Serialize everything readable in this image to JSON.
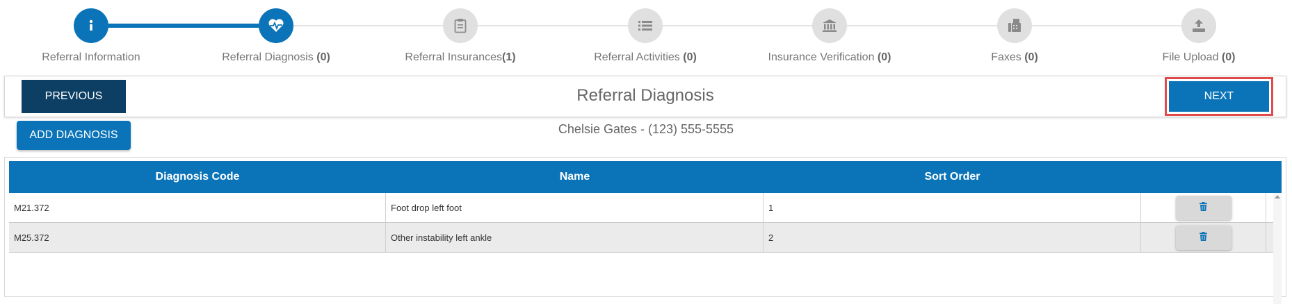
{
  "stepper": {
    "steps": [
      {
        "label": "Referral Information",
        "count": "",
        "icon": "info-icon",
        "active": true
      },
      {
        "label": "Referral Diagnosis ",
        "count": "(0)",
        "icon": "heart-pulse-icon",
        "active": true
      },
      {
        "label": "Referral Insurances",
        "count": "(1)",
        "icon": "clipboard-icon",
        "active": false
      },
      {
        "label": "Referral Activities ",
        "count": "(0)",
        "icon": "list-icon",
        "active": false
      },
      {
        "label": "Insurance Verification ",
        "count": "(0)",
        "icon": "bank-icon",
        "active": false
      },
      {
        "label": "Faxes ",
        "count": "(0)",
        "icon": "fax-icon",
        "active": false
      },
      {
        "label": "File Upload ",
        "count": "(0)",
        "icon": "upload-icon",
        "active": false
      }
    ]
  },
  "header": {
    "previous_label": "PREVIOUS",
    "title": "Referral Diagnosis",
    "next_label": "NEXT"
  },
  "add_diagnosis_label": "ADD DIAGNOSIS",
  "patient": "Chelsie Gates - (123) 555-5555",
  "grid": {
    "columns": [
      "Diagnosis Code",
      "Name",
      "Sort Order",
      ""
    ],
    "rows": [
      {
        "code": "M21.372",
        "name": "Foot drop left foot",
        "sort": "1"
      },
      {
        "code": "M25.372",
        "name": "Other instability left ankle",
        "sort": "2"
      }
    ]
  },
  "colors": {
    "primary": "#0b74b8",
    "dark_primary": "#0c3f63",
    "highlight": "#e04b4b",
    "inactive_step": "#e0e0e0"
  }
}
